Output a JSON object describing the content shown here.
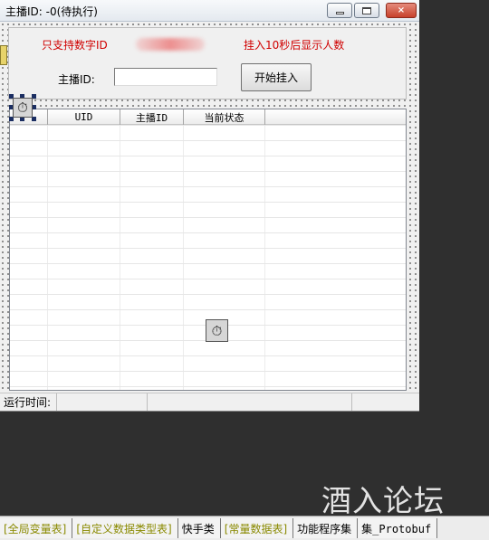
{
  "window": {
    "title": "主播ID: -0(待执行)",
    "close_glyph": "×"
  },
  "form": {
    "note_left": "只支持数字ID",
    "note_right": "挂入10秒后显示人数",
    "anchor_label": "主播ID:",
    "anchor_input_value": "",
    "start_button_label": "开始挂入"
  },
  "timer": {
    "glyph": "⏱"
  },
  "listview": {
    "columns": [
      "",
      "UID",
      "主播ID",
      "当前状态"
    ],
    "rows": []
  },
  "statusbar": {
    "runtime_label": "运行时间:",
    "runtime_value": "",
    "extra": ""
  },
  "watermark": {
    "text": "酒入论坛"
  },
  "tabs": [
    {
      "label": "[全局变量表]",
      "style": "olive"
    },
    {
      "label": "[自定义数据类型表]",
      "style": "olive"
    },
    {
      "label": "快手类",
      "style": "normal"
    },
    {
      "label": "[常量数据表]",
      "style": "olive"
    },
    {
      "label": "功能程序集",
      "style": "normal"
    },
    {
      "label": "集_Protobuf",
      "style": "mono"
    }
  ],
  "colors": {
    "red_note": "#d00000",
    "olive_tab": "#8a8a00",
    "workspace_bg": "#2f2f2f"
  }
}
